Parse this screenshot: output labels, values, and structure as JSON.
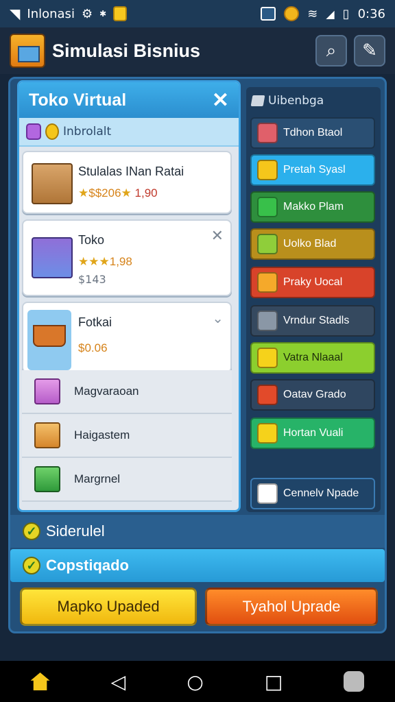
{
  "status_bar": {
    "carrier": "Inlonasi",
    "time": "0:36"
  },
  "header": {
    "title": "Simulasi Bisnius",
    "search_icon": "search-icon",
    "tools_icon": "tools-icon"
  },
  "left_panel": {
    "title": "Toko Virtual",
    "subtitle": "Inbrolalt",
    "cards": [
      {
        "name": "Stulalas INan Ratai",
        "price_text": "$$206",
        "rating_text": "1,90"
      },
      {
        "name": "Toko",
        "rating_text": "1,98",
        "price_text": "$143"
      },
      {
        "name": "Fotkai",
        "price_text": "$0.06"
      }
    ],
    "list": [
      {
        "name": "Magvaraoan"
      },
      {
        "name": "Haigastem"
      },
      {
        "name": "Margrnel"
      }
    ]
  },
  "right_panel": {
    "title": "Uibenbga",
    "buttons": [
      {
        "label": "Tdhon Btaol",
        "color": "#2a4f73",
        "icon_color": "#e0606a"
      },
      {
        "label": "Pretah Syasl",
        "color": "#2bb0ec",
        "icon_color": "#f5c61b"
      },
      {
        "label": "Makko Plam",
        "color": "#2e8f3d",
        "icon_color": "#38c04a"
      },
      {
        "label": "Uolko Blad",
        "color": "#b98f1c",
        "icon_color": "#8fce3a"
      },
      {
        "label": "Praky Uocal",
        "color": "#d8432a",
        "icon_color": "#f5a92a"
      },
      {
        "label": "Vrndur Stadls",
        "color": "#35495f",
        "icon_color": "#8a97a6"
      },
      {
        "label": "Vatra Nlaaal",
        "color": "#8ccf2e",
        "icon_color": "#f5d21b"
      },
      {
        "label": "Oatav Grado",
        "color": "#2f4660",
        "icon_color": "#e24a2a"
      },
      {
        "label": "Hortan Vuali",
        "color": "#27b368",
        "icon_color": "#f5d21b"
      }
    ],
    "bottom_button": "Cennelv Npade"
  },
  "bars": {
    "sidebar_label": "Siderulel",
    "completed_label": "Copstiqado"
  },
  "actions": {
    "left": "Mapko Upaded",
    "right": "Tyahol Uprade"
  }
}
